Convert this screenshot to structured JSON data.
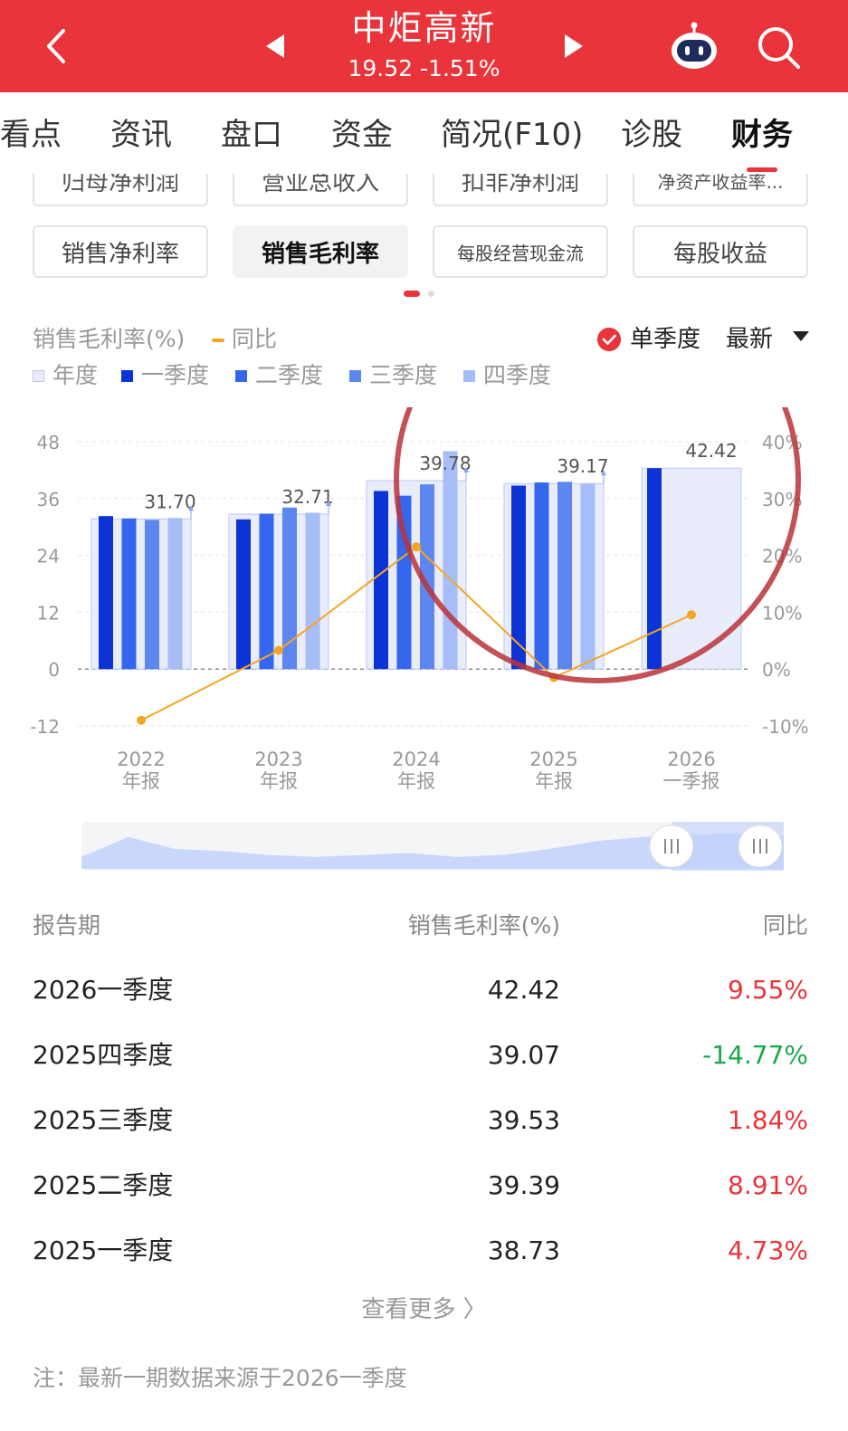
{
  "header": {
    "stock_name": "中炬高新",
    "price": "19.52",
    "change": "-1.51%",
    "colors": {
      "brand": "#e8343a",
      "rise": "#e8343a",
      "fall": "#19a84c"
    }
  },
  "tabs": [
    {
      "label": "看点"
    },
    {
      "label": "资讯"
    },
    {
      "label": "盘口"
    },
    {
      "label": "资金"
    },
    {
      "label": "简况(F10)"
    },
    {
      "label": "诊股"
    },
    {
      "label": "财务"
    }
  ],
  "metric_buttons_row1": [
    "归母净利润",
    "营业总收入",
    "扣非净利润",
    "净资产收益率..."
  ],
  "metric_buttons_row2": [
    "销售净利率",
    "销售毛利率",
    "每股经营现金流",
    "每股收益"
  ],
  "chart_header": {
    "title": "销售毛利率(%)",
    "yoy_legend": "同比",
    "single_quarter": "单季度",
    "latest": "最新",
    "legend": [
      "年度",
      "一季度",
      "二季度",
      "三季度",
      "四季度"
    ]
  },
  "chart_data": {
    "type": "bar",
    "categories": [
      [
        "2022",
        "年报"
      ],
      [
        "2023",
        "年报"
      ],
      [
        "2024",
        "年报"
      ],
      [
        "2025",
        "年报"
      ],
      [
        "2026",
        "一季报"
      ]
    ],
    "series": [
      {
        "name": "年度",
        "values": [
          31.7,
          32.71,
          39.78,
          39.17,
          42.42
        ],
        "color": "#e9ecfb"
      },
      {
        "name": "一季度",
        "values": [
          32.3,
          31.6,
          37.6,
          38.73,
          42.42
        ],
        "color": "#0b33d6"
      },
      {
        "name": "二季度",
        "values": [
          31.8,
          32.8,
          36.6,
          39.39,
          null
        ],
        "color": "#3466ee"
      },
      {
        "name": "三季度",
        "values": [
          31.5,
          34.1,
          39.0,
          39.53,
          null
        ],
        "color": "#5d86f0"
      },
      {
        "name": "四季度",
        "values": [
          31.9,
          33.0,
          46.0,
          39.07,
          null
        ],
        "color": "#a6bdf7"
      }
    ],
    "yoy": {
      "name": "同比",
      "values": [
        -9.0,
        3.3,
        21.5,
        -1.5,
        9.55
      ],
      "color": "#f5a524"
    },
    "data_labels": [
      "31.70",
      "32.71",
      "39.78",
      "39.17",
      "42.42"
    ],
    "y_left": {
      "ticks": [
        48,
        36,
        24,
        12,
        0,
        -12
      ],
      "range": [
        -12,
        48
      ]
    },
    "y_right": {
      "ticks": [
        "40%",
        "30%",
        "20%",
        "10%",
        "0%",
        "-10%"
      ],
      "range": [
        -10,
        40
      ]
    },
    "grid": true
  },
  "minimap": {
    "values": [
      0.3,
      0.8,
      0.5,
      0.45,
      0.35,
      0.3,
      0.35,
      0.4,
      0.3,
      0.35,
      0.5,
      0.7,
      0.8,
      0.85,
      0.9,
      0.8
    ]
  },
  "table": {
    "headers": [
      "报告期",
      "销售毛利率(%)",
      "同比"
    ],
    "rows": [
      {
        "period": "2026一季度",
        "value": "42.42",
        "yoy": "9.55%",
        "trend": "up"
      },
      {
        "period": "2025四季度",
        "value": "39.07",
        "yoy": "-14.77%",
        "trend": "down"
      },
      {
        "period": "2025三季度",
        "value": "39.53",
        "yoy": "1.84%",
        "trend": "up"
      },
      {
        "period": "2025二季度",
        "value": "39.39",
        "yoy": "8.91%",
        "trend": "up"
      },
      {
        "period": "2025一季度",
        "value": "38.73",
        "yoy": "4.73%",
        "trend": "up"
      }
    ]
  },
  "more": "查看更多 〉",
  "note": "注：最新一期数据来源于2026一季度"
}
